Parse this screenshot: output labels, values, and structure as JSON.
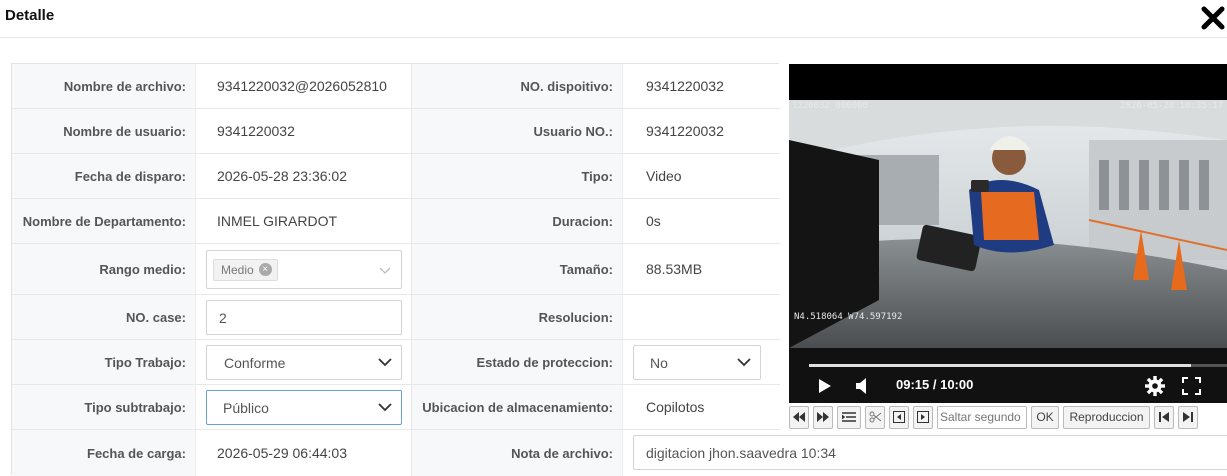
{
  "header": {
    "title": "Detalle",
    "close_icon": "close-x-icon"
  },
  "fields": {
    "nombre_archivo": {
      "label": "Nombre de archivo:",
      "value": "9341220032@2026052810"
    },
    "no_dispositivo": {
      "label": "NO. dispoitivo:",
      "value": "9341220032"
    },
    "nombre_usuario": {
      "label": "Nombre de usuario:",
      "value": "9341220032"
    },
    "usuario_no": {
      "label": "Usuario NO.:",
      "value": "9341220032"
    },
    "fecha_disparo": {
      "label": "Fecha de disparo:",
      "value": "2026-05-28 23:36:02"
    },
    "tipo": {
      "label": "Tipo:",
      "value": "Video"
    },
    "departamento": {
      "label": "Nombre de Departamento:",
      "value": "INMEL GIRARDOT"
    },
    "duracion": {
      "label": "Duracion:",
      "value": "0s"
    },
    "rango_medio": {
      "label": "Rango medio:",
      "tag": "Medio",
      "tag_remove": "×"
    },
    "tamano": {
      "label": "Tamaño:",
      "value": "88.53MB"
    },
    "no_case": {
      "label": "NO. case:",
      "value": "2"
    },
    "resolucion": {
      "label": "Resolucion:",
      "value": ""
    },
    "tipo_trabajo": {
      "label": "Tipo Trabajo:",
      "value": "Conforme"
    },
    "estado_proteccion": {
      "label": "Estado de proteccion:",
      "value": "No"
    },
    "tipo_subtrabajo": {
      "label": "Tipo subtrabajo:",
      "value": "Público"
    },
    "ubicacion": {
      "label": "Ubicacion de almacenamiento:",
      "value": "Copilotos"
    },
    "fecha_carga": {
      "label": "Fecha de carga:",
      "value": "2026-05-29 06:44:03"
    },
    "nota_archivo": {
      "label": "Nota de archivo:",
      "value": "digitacion jhon.saavedra 10:34"
    }
  },
  "player": {
    "osd_top_left": "1220032_000000",
    "osd_top_right": "2026-05-28 10:35:17",
    "osd_gps": "N4.518064 W74.597192",
    "time": "09:15 / 10:00",
    "progress": 0.915,
    "icons": [
      "play-icon",
      "volume-icon",
      "settings-gear-icon",
      "fullscreen-icon"
    ]
  },
  "toolbar": {
    "seek_placeholder": "Saltar segundo",
    "ok_label": "OK",
    "playback_label": "Reproduccion",
    "icons": [
      "rewind-icon",
      "fast-forward-icon",
      "list-icon",
      "scissors-icon",
      "prev-frame-icon",
      "next-frame-icon",
      "skip-start-icon",
      "skip-end-icon"
    ]
  }
}
